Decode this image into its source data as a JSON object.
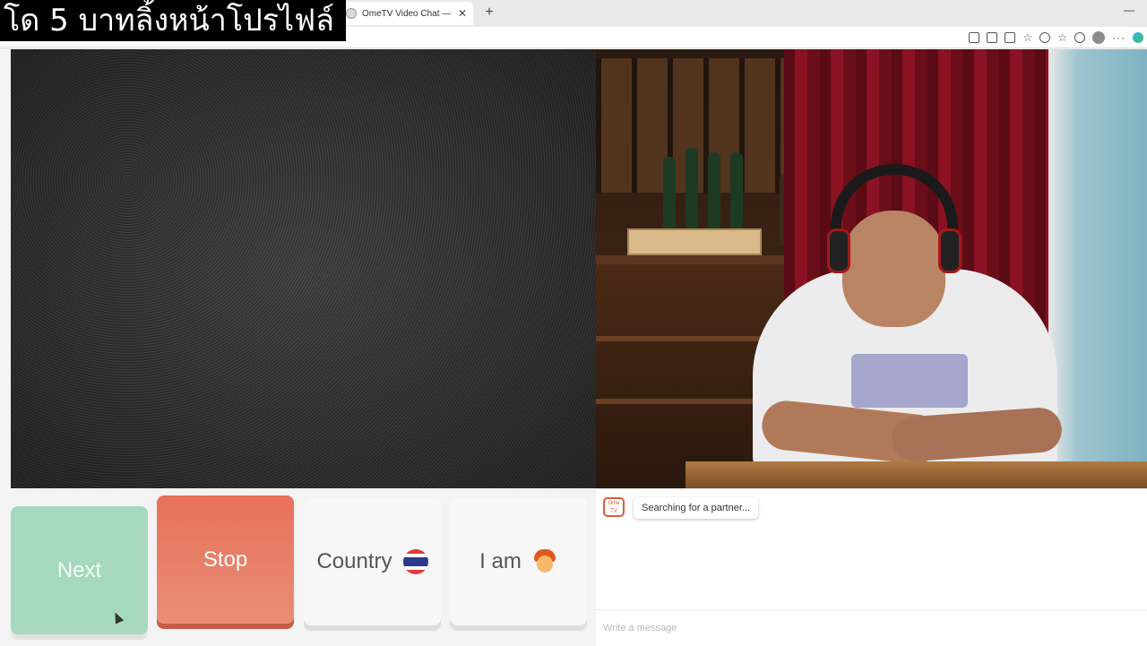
{
  "browser": {
    "tab_title": "OmeTV Video Chat — Omegle",
    "close_glyph": "✕",
    "new_tab_glyph": "+",
    "minimize_glyph": "—",
    "more_glyph": "···"
  },
  "overlay": {
    "caption": "โด 5 บาทลิ้งหน้าโปรไฟล์"
  },
  "controls": {
    "next_label": "Next",
    "stop_label": "Stop",
    "country_label": "Country",
    "country_flag": "thailand-flag-icon",
    "iam_label": "I am",
    "iam_icon": "person-emoji-icon"
  },
  "chat": {
    "logo_text": "Ome TV",
    "status_message": "Searching for a partner...",
    "input_placeholder": "Write a message"
  },
  "colors": {
    "next": "#a5d8bc",
    "stop": "#e8705a",
    "neutral": "#f7f7f7"
  }
}
